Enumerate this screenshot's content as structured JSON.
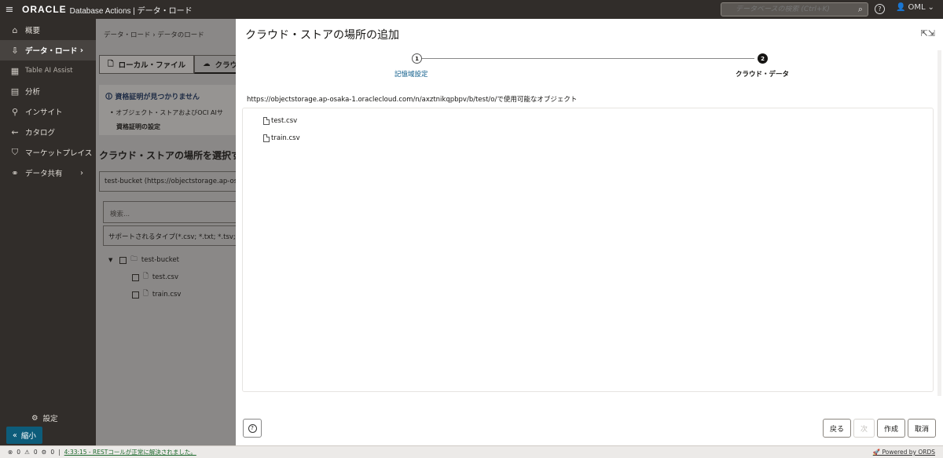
{
  "topbar": {
    "logo": "ORACLE",
    "app_title": "Database Actions | データ・ロード",
    "search_placeholder": "データベースの検索 (Ctrl+K)",
    "user": "OML"
  },
  "sidebar": {
    "items": [
      {
        "label": "概要",
        "icon": "home-icon"
      },
      {
        "label": "データ・ロード",
        "icon": "data-load-icon",
        "active": true
      },
      {
        "label": "Table AI Assist",
        "icon": "table-ai-icon"
      },
      {
        "label": "分析",
        "icon": "analysis-icon"
      },
      {
        "label": "インサイト",
        "icon": "insight-icon"
      },
      {
        "label": "カタログ",
        "icon": "catalog-icon"
      },
      {
        "label": "マーケットプレイス",
        "icon": "marketplace-icon"
      },
      {
        "label": "データ共有",
        "icon": "share-icon"
      }
    ],
    "settings": "設定",
    "collapse": "縮小"
  },
  "background": {
    "breadcrumb": "データ・ロード › データのロード",
    "tabs": [
      "ローカル・ファイル",
      "クラウド"
    ],
    "alert_title": "資格証明が見つかりません",
    "alert_body": "• オブジェクト・ストアおよびOCI AIサ",
    "alert_link": "資格証明の設定",
    "section_title": "クラウド・ストアの場所を選択する",
    "bucket_value": "test-bucket (https://objectstorage.ap-osaka",
    "search_placeholder": "検索...",
    "types_value": "サポートされるタイプ(*.csv; *.txt; *.tsv; *.p",
    "tree": {
      "bucket": "test-bucket",
      "files": [
        "test.csv",
        "train.csv"
      ]
    }
  },
  "dialog": {
    "title": "クラウド・ストアの場所の追加",
    "steps": [
      {
        "num": "1",
        "label": "記憶域設定"
      },
      {
        "num": "2",
        "label": "クラウド・データ"
      }
    ],
    "url_line": "https://objectstorage.ap-osaka-1.oraclecloud.com/n/axztnikqpbpv/b/test/o/で使用可能なオブジェクト",
    "files": [
      "test.csv",
      "train.csv"
    ],
    "buttons": {
      "back": "戻る",
      "next": "次",
      "create": "作成",
      "cancel": "取消"
    },
    "help": "?"
  },
  "statusbar": {
    "errors": "0",
    "warnings": "0",
    "tasks": "0",
    "message": "4:33:15 - RESTコールが正常に解決されました。",
    "powered": "Powered by ORDS"
  }
}
